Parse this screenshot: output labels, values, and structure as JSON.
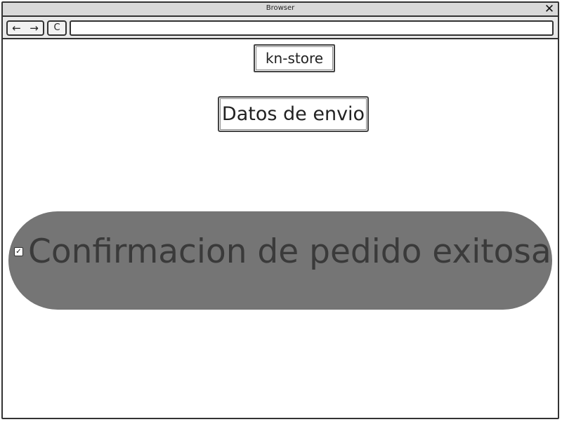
{
  "window": {
    "title": "Browser",
    "close_icon": "close-icon"
  },
  "toolbar": {
    "back_icon": "←",
    "forward_icon": "→",
    "reload_icon": "C",
    "address_value": ""
  },
  "page": {
    "store_label": "kn-store",
    "shipping_button": "Datos de envio",
    "confirmation": {
      "text": "Confirmacion de pedido exitosa",
      "checked": true,
      "check_glyph": "✓",
      "background_color": "#757575"
    }
  },
  "icons": {
    "close": "✕"
  }
}
